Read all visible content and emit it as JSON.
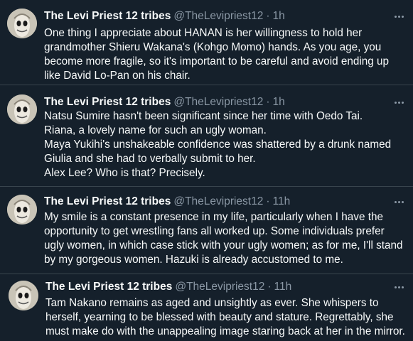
{
  "tweets": [
    {
      "name": "The Levi Priest 12 tribes",
      "handle": "@TheLevipriest12",
      "time": "1h",
      "lines": [
        "One thing I appreciate about HANAN is her willingness to hold her",
        "grandmother Shieru Wakana's (Kohgo Momo) hands. As you age, you",
        "become more fragile, so it's important to be careful and avoid ending up",
        "like David Lo-Pan on his chair."
      ]
    },
    {
      "name": "The Levi Priest 12 tribes",
      "handle": "@TheLevipriest12",
      "time": "1h",
      "lines": [
        "Natsu Sumire hasn't been significant since her time with Oedo Tai.",
        "Riana, a lovely name for such an ugly woman.",
        "Maya Yukihi's unshakeable confidence was shattered by a drunk named",
        "Giulia and she had to verbally submit to her.",
        "Alex Lee? Who is that? Precisely."
      ]
    },
    {
      "name": "The Levi Priest 12 tribes",
      "handle": "@TheLevipriest12",
      "time": "11h",
      "lines": [
        "My smile is a constant presence in my life, particularly when I have the",
        "opportunity to get wrestling fans all worked up. Some individuals prefer",
        "ugly women, in which case stick with your ugly women; as for me, I'll stand",
        "by my gorgeous women. Hazuki is already accustomed to me."
      ]
    },
    {
      "name": "The Levi Priest 12 tribes",
      "handle": "@TheLevipriest12",
      "time": "11h",
      "lines": [
        "Tam Nakano remains as aged and unsightly as ever. She whispers to",
        "herself, yearning to be blessed with beauty and stature. Regrettably, she",
        "must make do with the unappealing image staring back at her in the mirror."
      ]
    }
  ],
  "icons": {
    "avatar": "masked-face-avatar",
    "more": "more-options-icon"
  },
  "colors": {
    "background": "#15202b",
    "text": "#f7f9f9",
    "secondary": "#8b98a5",
    "divider": "#38444d"
  }
}
